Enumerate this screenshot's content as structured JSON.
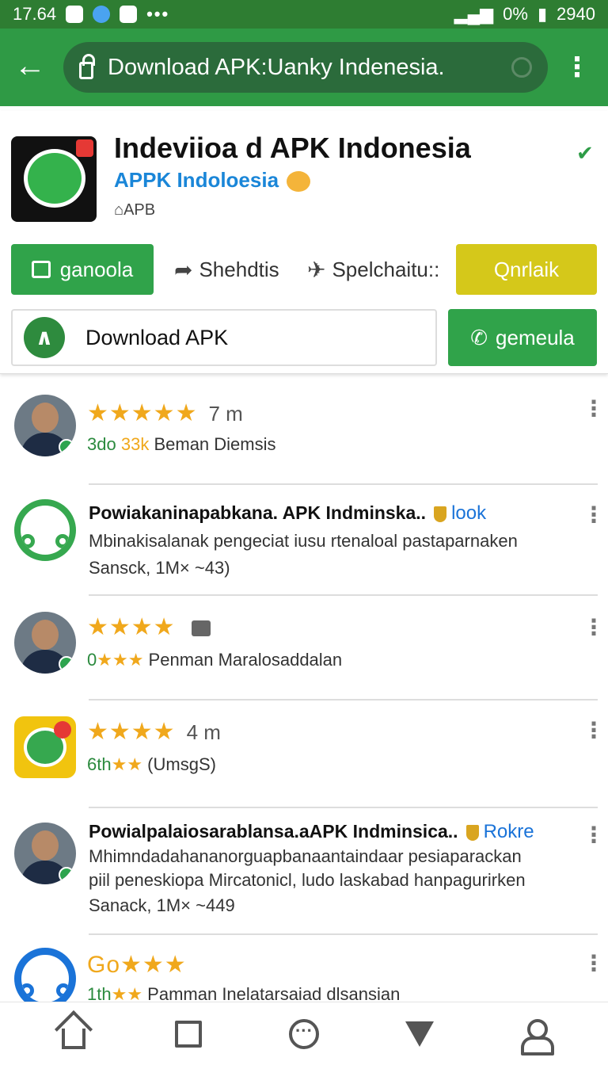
{
  "status_bar": {
    "time": "17.64",
    "dots": "•••",
    "right_text": "0%",
    "battery_text": "2940"
  },
  "toolbar": {
    "back": "←",
    "url": "Download APK:Uanky Indenesia.",
    "menu": "⋮"
  },
  "app": {
    "title": "Indeviioa d APK Indonesia",
    "developer": "APPK Indoloesia",
    "tag": "⌂APB",
    "actions": {
      "primary": "ganoola",
      "share": "Shehdtis",
      "send": "Spelchaitu::",
      "secondary": "Qnrlaik"
    },
    "download_label": "Download APK",
    "call_label": "gemeula"
  },
  "list": [
    {
      "type": "rating",
      "stars": "★★★★★",
      "meta": "7 m",
      "sub_green": "3do",
      "sub_yellow": "33k",
      "sub_text": "Beman Diemsis"
    },
    {
      "type": "post",
      "title": "Powiakaninapabkana. APK Indminska..",
      "tag": "look",
      "line1": "Mbinakisalanak pengeciat iusu rtenaloal pastaparnaken",
      "line2": "Sansck, 1M× ~43)"
    },
    {
      "type": "rating",
      "stars": "★★★★",
      "meta": "",
      "sub_green": "0",
      "sub_yellow": "★★★",
      "sub_text": "Penman Maralosaddalan"
    },
    {
      "type": "rating",
      "stars": "★★★★",
      "meta": "4 m",
      "sub_green": "6th",
      "sub_yellow": "★★",
      "sub_text": "(UmsgS)"
    },
    {
      "type": "post",
      "title": "Powialpalaiosarablansa.aAPK Indminsica..",
      "tag": "Rokre",
      "line1": "Mhimndadahananorguapbanaantaindaar pesiaparackan",
      "line2": "piil peneskiopa Mircatonicl, ludo laskabad hanpagurirken",
      "line3": "Sanack, 1M× ~449"
    },
    {
      "type": "rating",
      "stars": "Go★★★",
      "meta": "",
      "sub_green": "1th",
      "sub_yellow": "★★",
      "sub_text": "Pamman Inelatarsaiad dlsansian"
    }
  ],
  "colors": {
    "toolbar_green": "#2f9a45",
    "button_green": "#30a34a",
    "button_yellow": "#d5c81a",
    "star": "#f0a81c",
    "link_blue": "#1a73d8"
  }
}
